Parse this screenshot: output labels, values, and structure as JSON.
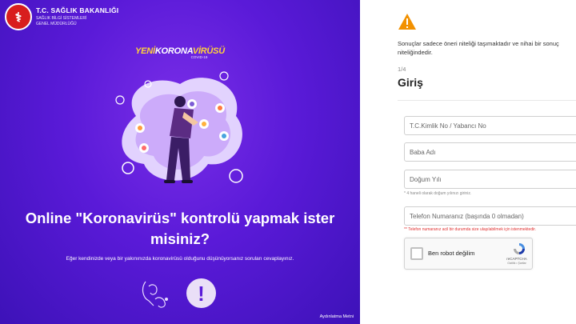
{
  "ministry": {
    "title": "T.C. SAĞLIK BAKANLIĞI",
    "subtitle_line1": "SAĞLIK BİLGİ SİSTEMLERİ",
    "subtitle_line2": "GENEL MÜDÜRLÜĞÜ",
    "seal_icon": "ministry-seal-icon"
  },
  "campaign": {
    "brand_prefix": "YENİ",
    "brand_highlight": "KORONA",
    "brand_suffix": "VİRÜSÜ",
    "brand_tag": "COVID-19"
  },
  "left": {
    "headline": "Online \"Koronavirüs\" kontrolü yapmak ister misiniz?",
    "subtext": "Eğer kendinizde veya bir yakınınızda koronavirüsü olduğunu düşünüyorsanız soruları cevaplayınız.",
    "info_icon": "exclamation-icon",
    "footer_link": "Aydınlatma Metni"
  },
  "right": {
    "notice_line1": "Sonuçlar sadece öneri niteliği taşımaktadır ve nihai bir sonuç",
    "notice_line2": "niteliğindedir.",
    "step": "1/4",
    "title": "Giriş",
    "fields": {
      "tc_placeholder": "T.C.Kimlik No / Yabancı No",
      "father_placeholder": "Baba Adı",
      "birthyear_placeholder": "Doğum Yılı",
      "birthyear_hint": "* 4 haneli olarak doğum yılınızı giriniz.",
      "phone_placeholder": "Telefon Numaranız (başında 0 olmadan)",
      "phone_hint": "** Telefon numaranız acil bir durumda size ulaşılabilmek için istenmektedir."
    },
    "recaptcha": {
      "label": "Ben robot değilim",
      "brand": "reCAPTCHA",
      "terms": "Gizlilik • Şartlar"
    }
  },
  "colors": {
    "purple_dark": "#3d12b8",
    "purple": "#5a1ad8",
    "accent_yellow": "#ffd23a",
    "warning_orange": "#f29100",
    "error_red": "#e03030"
  }
}
